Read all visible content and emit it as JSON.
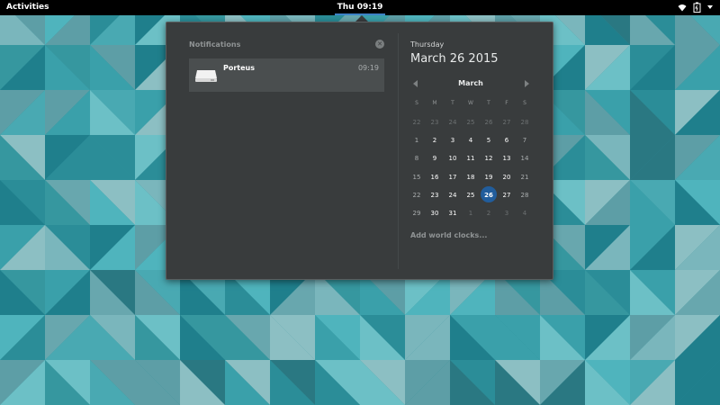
{
  "topbar": {
    "activities": "Activities",
    "clock": "Thu 09:19",
    "tray_icons": [
      "wifi-icon",
      "battery-icon",
      "power-icon"
    ]
  },
  "notifications": {
    "title": "Notifications",
    "clear_icon": "close-icon",
    "items": [
      {
        "app": "Porteus",
        "time": "09:19",
        "icon": "drive-icon"
      }
    ]
  },
  "calendar": {
    "weekday": "Thursday",
    "date": "March 26 2015",
    "month": "March",
    "weekdays": [
      "S",
      "M",
      "T",
      "W",
      "T",
      "F",
      "S"
    ],
    "days": [
      [
        "22",
        "23",
        "24",
        "25",
        "26",
        "27",
        "28"
      ],
      [
        "1",
        "2",
        "3",
        "4",
        "5",
        "6",
        "7"
      ],
      [
        "8",
        "9",
        "10",
        "11",
        "12",
        "13",
        "14"
      ],
      [
        "15",
        "16",
        "17",
        "18",
        "19",
        "20",
        "21"
      ],
      [
        "22",
        "23",
        "24",
        "25",
        "26",
        "27",
        "28"
      ],
      [
        "29",
        "30",
        "31",
        "1",
        "2",
        "3",
        "4"
      ]
    ],
    "today": "26",
    "world_clocks": "Add world clocks..."
  },
  "colors": {
    "topbar": "#000000",
    "panel": "#393c3d",
    "accent": "#215d9c",
    "wallpaper": "#2f8f9a"
  }
}
